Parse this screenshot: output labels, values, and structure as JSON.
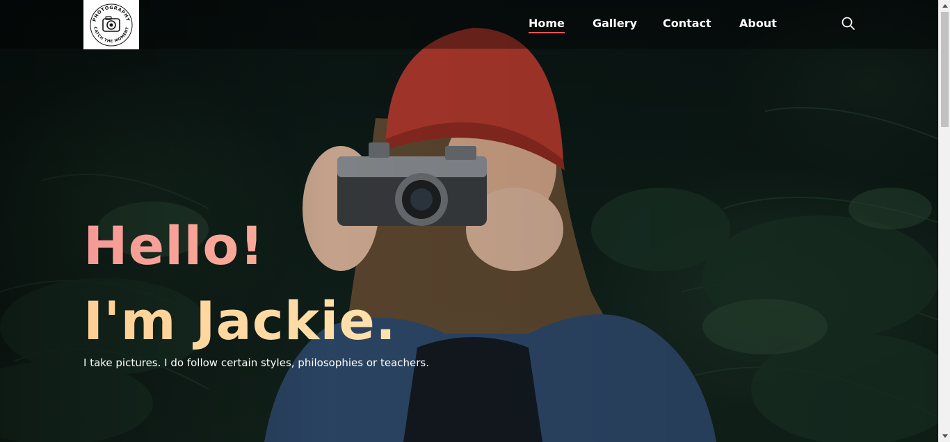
{
  "logo": {
    "arc_top": "PHOTOGRAPHY",
    "arc_bottom": "CATCH THE MOMENT",
    "icon": "camera-icon"
  },
  "nav": {
    "items": [
      {
        "label": "Home",
        "active": true
      },
      {
        "label": "Gallery",
        "active": false
      },
      {
        "label": "Contact",
        "active": false
      },
      {
        "label": "About",
        "active": false
      }
    ],
    "search_icon": "search-icon"
  },
  "hero": {
    "greeting": "Hello!",
    "name": "I'm Jackie.",
    "tagline": "I take pictures. I do follow certain styles, philosophies or teachers."
  },
  "colors": {
    "accent": "#f2545b",
    "greeting_gradient_start": "#f59a96",
    "name_gradient_start": "#ffcf95",
    "text": "#ffffff"
  }
}
